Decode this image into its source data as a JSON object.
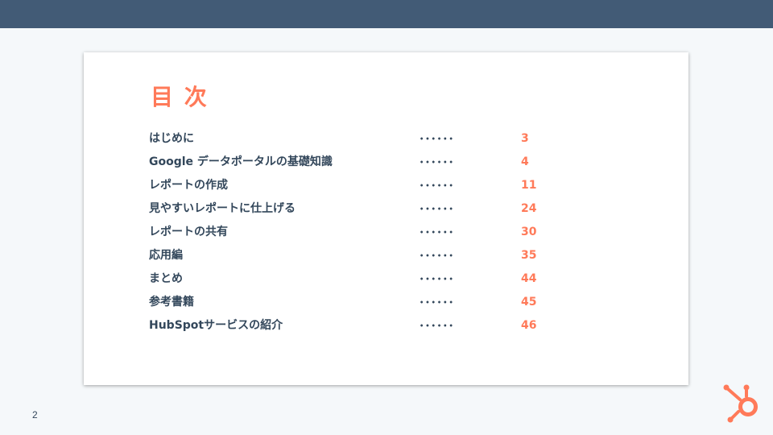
{
  "slide": {
    "title": "目 次",
    "page_number": "2",
    "accent_color": "#ff7a59",
    "header_color": "#425b76",
    "text_color": "#33475b"
  },
  "toc": {
    "items": [
      {
        "label": "はじめに",
        "page": "3"
      },
      {
        "label": "Google データポータルの基礎知識",
        "page": "4"
      },
      {
        "label": "レポートの作成",
        "page": "11"
      },
      {
        "label": "見やすいレポートに仕上げる",
        "page": "24"
      },
      {
        "label": "レポートの共有",
        "page": "30"
      },
      {
        "label": "応用編",
        "page": "35"
      },
      {
        "label": "まとめ",
        "page": "44"
      },
      {
        "label": "参考書籍",
        "page": "45"
      },
      {
        "label": "HubSpotサービスの紹介",
        "page": "46"
      }
    ]
  },
  "logo": {
    "icon": "hubspot-sprocket-icon"
  }
}
